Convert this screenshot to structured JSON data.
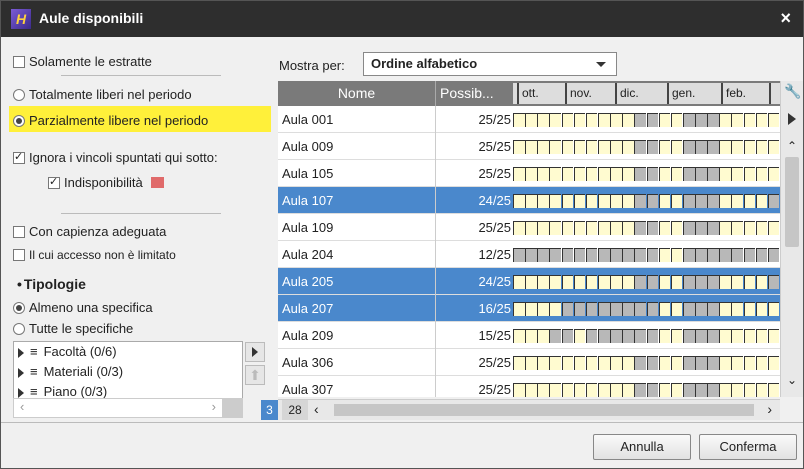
{
  "window": {
    "title": "Aule disponibili",
    "app_icon_letter": "H",
    "close_glyph": "×"
  },
  "left": {
    "solamente": {
      "label": "Solamente le estratte",
      "checked": false
    },
    "totalmente": {
      "label": "Totalmente liberi nel periodo",
      "checked": false
    },
    "parzialmente": {
      "label": "Parzialmente libere nel periodo",
      "checked": true
    },
    "ignora": {
      "label": "Ignora i vincoli spuntati qui sotto:",
      "checked": true
    },
    "indisponibilita": {
      "label": "Indisponibilità",
      "checked": true,
      "swatch_color": "#e06a6a"
    },
    "capienza": {
      "label": "Con capienza adeguata",
      "checked": false
    },
    "accesso": {
      "label": "Il cui accesso non è limitato",
      "checked": false
    },
    "tipologie_title": "Tipologie",
    "almeno": {
      "label": "Almeno una specifica",
      "checked": true
    },
    "tutte": {
      "label": "Tutte le specifiche",
      "checked": false
    },
    "tree": [
      {
        "label": "Facoltà (0/6)"
      },
      {
        "label": "Materiali (0/3)"
      },
      {
        "label": "Piano (0/3)"
      }
    ],
    "highlight_color": "#fff03a"
  },
  "mostra": {
    "label": "Mostra per:",
    "value": "Ordine alfabetico"
  },
  "table": {
    "col_name": "Nome",
    "col_pos": "Possib...",
    "months": [
      "ott.",
      "nov.",
      "dic.",
      "gen.",
      "feb."
    ],
    "rows": [
      {
        "name": "Aula 001",
        "pos": "25/25",
        "selected": false
      },
      {
        "name": "Aula 009",
        "pos": "25/25",
        "selected": false
      },
      {
        "name": "Aula 105",
        "pos": "25/25",
        "selected": false
      },
      {
        "name": "Aula 107",
        "pos": "24/25",
        "selected": true
      },
      {
        "name": "Aula 109",
        "pos": "25/25",
        "selected": false
      },
      {
        "name": "Aula 204",
        "pos": "12/25",
        "selected": false
      },
      {
        "name": "Aula 205",
        "pos": "24/25",
        "selected": true
      },
      {
        "name": "Aula 207",
        "pos": "16/25",
        "selected": true
      },
      {
        "name": "Aula 209",
        "pos": "15/25",
        "selected": false
      },
      {
        "name": "Aula 306",
        "pos": "25/25",
        "selected": false
      },
      {
        "name": "Aula 307",
        "pos": "25/25",
        "selected": false
      }
    ],
    "selected_color": "#4a88cc"
  },
  "footer_counts": {
    "selected": "3",
    "total": "28"
  },
  "buttons": {
    "cancel": "Annulla",
    "confirm": "Conferma"
  }
}
